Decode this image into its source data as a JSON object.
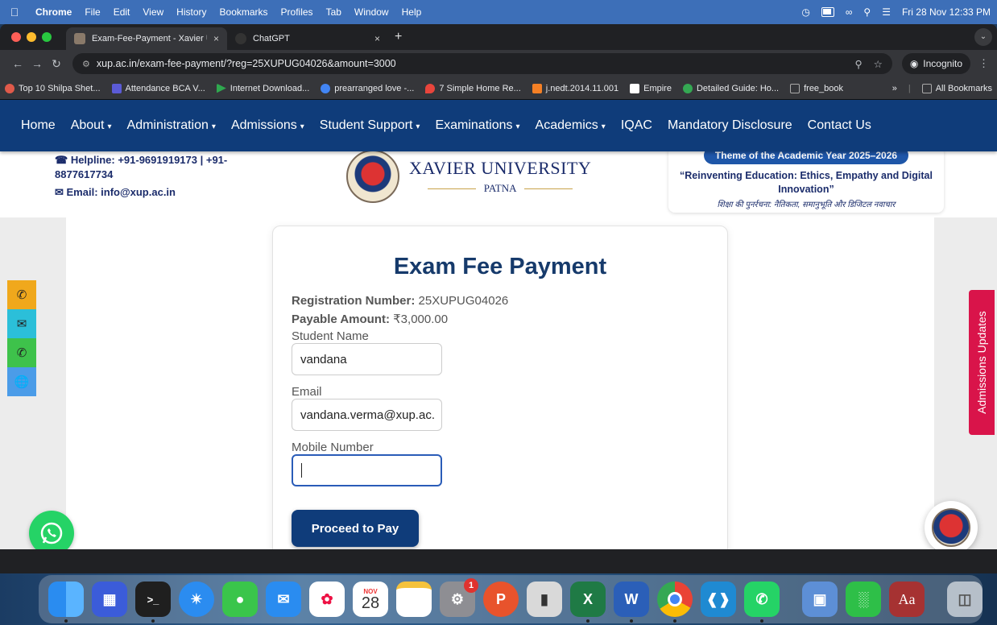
{
  "os_menu": {
    "app": "Chrome",
    "items": [
      "File",
      "Edit",
      "View",
      "History",
      "Bookmarks",
      "Profiles",
      "Tab",
      "Window",
      "Help"
    ],
    "datetime": "Fri 28 Nov  12:33 PM"
  },
  "tabs": [
    {
      "title": "Exam-Fee-Payment - Xavier U",
      "close": "×"
    },
    {
      "title": "ChatGPT",
      "close": "×"
    }
  ],
  "newtab": "+",
  "address": {
    "url": "xup.ac.in/exam-fee-payment/?reg=25XUPUG04026&amount=3000",
    "incognito": "Incognito"
  },
  "bookmarks": [
    {
      "label": "Top 10 Shilpa Shet...",
      "color": "#e05a4a"
    },
    {
      "label": "Attendance BCA V...",
      "color": "#5b5bd6"
    },
    {
      "label": "Internet Download...",
      "color": "#2fa84f"
    },
    {
      "label": "prearranged love -...",
      "color": "#4285f4"
    },
    {
      "label": "7 Simple Home Re...",
      "color": "#e8453c"
    },
    {
      "label": "j.nedt.2014.11.001",
      "color": "#f58025"
    },
    {
      "label": "Empire",
      "color": "#ffffff"
    },
    {
      "label": "Detailed Guide: Ho...",
      "color": "#34a853"
    },
    {
      "label": "free_book",
      "color": "#aaaaaa"
    }
  ],
  "bookmarks_more": "»",
  "bookmarks_all": "All Bookmarks",
  "site_nav": [
    {
      "label": "Home",
      "dropdown": false
    },
    {
      "label": "About",
      "dropdown": true
    },
    {
      "label": "Administration",
      "dropdown": true
    },
    {
      "label": "Admissions",
      "dropdown": true
    },
    {
      "label": "Student Support",
      "dropdown": true
    },
    {
      "label": "Examinations",
      "dropdown": true
    },
    {
      "label": "Academics",
      "dropdown": true
    },
    {
      "label": "IQAC",
      "dropdown": false
    },
    {
      "label": "Mandatory Disclosure",
      "dropdown": false
    },
    {
      "label": "Contact Us",
      "dropdown": false
    }
  ],
  "nav_caret": "▾",
  "header": {
    "helpline": "Helpline: +91-9691919173 | +91-8877617734",
    "email": "Email: info@xup.ac.in",
    "university": "XAVIER UNIVERSITY",
    "city": "PATNA",
    "theme_pill": "Theme of the Academic Year 2025–2026",
    "theme_quote": "“Reinventing Education: Ethics, Empathy and Digital Innovation”",
    "theme_hindi": "शिक्षा की पुनर्रचना: नैतिकता, समानुभूति और डिजिटल नवाचार"
  },
  "form": {
    "title": "Exam Fee Payment",
    "reg_label": "Registration Number:",
    "reg_value": "25XUPUG04026",
    "amount_label": "Payable Amount:",
    "amount_value": "₹3,000.00",
    "name_label": "Student Name",
    "name_value": "vandana",
    "email_label": "Email",
    "email_value": "vandana.verma@xup.ac.",
    "mobile_label": "Mobile Number",
    "mobile_value": "",
    "submit": "Proceed to Pay"
  },
  "side_tab": "Admissions Updates",
  "dock": {
    "calendar_month": "NOV",
    "calendar_day": "28",
    "settings_badge": "1",
    "dictionary": "Aa"
  }
}
